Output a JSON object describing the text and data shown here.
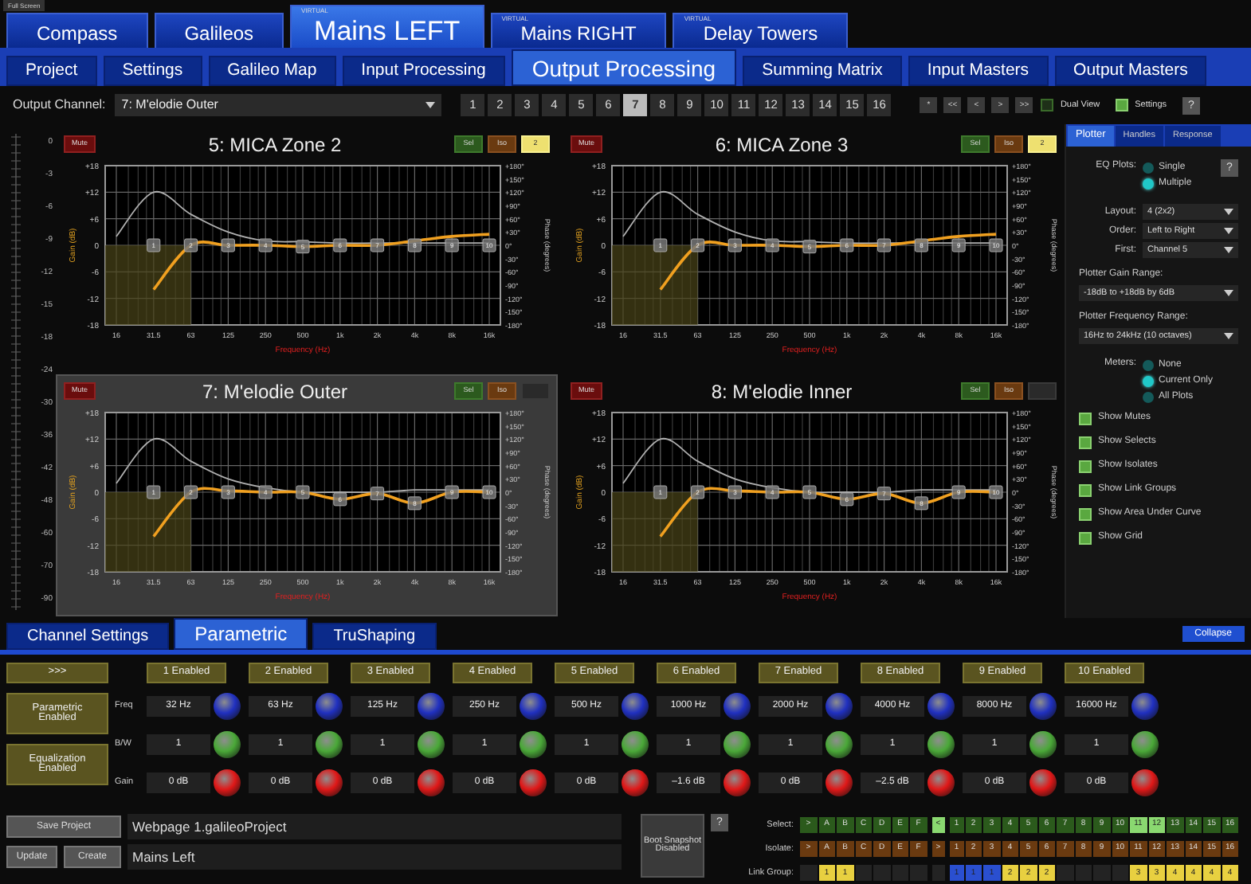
{
  "full_screen_button": "Full Screen",
  "top_tabs": [
    {
      "label": "Compass",
      "selected": false
    },
    {
      "label": "Galileos",
      "selected": false
    },
    {
      "label": "Mains LEFT",
      "tag": "VIRTUAL",
      "selected": true
    },
    {
      "label": "Mains RIGHT",
      "tag": "VIRTUAL",
      "selected": false
    },
    {
      "label": "Delay Towers",
      "tag": "VIRTUAL",
      "selected": false
    }
  ],
  "sub_tabs": [
    {
      "label": "Project",
      "selected": false
    },
    {
      "label": "Settings",
      "selected": false
    },
    {
      "label": "Galileo Map",
      "selected": false
    },
    {
      "label": "Input Processing",
      "selected": false
    },
    {
      "label": "Output Processing",
      "selected": true
    },
    {
      "label": "Summing Matrix",
      "selected": false
    },
    {
      "label": "Input Masters",
      "selected": false
    },
    {
      "label": "Output Masters",
      "selected": false
    }
  ],
  "toolbar": {
    "channel_label": "Output Channel:",
    "channel_value": "7: M'elodie Outer",
    "channels": [
      {
        "label": "1",
        "selected": false
      },
      {
        "label": "2",
        "selected": false
      },
      {
        "label": "3",
        "selected": false
      },
      {
        "label": "4",
        "selected": false
      },
      {
        "label": "5",
        "selected": false
      },
      {
        "label": "6",
        "selected": false
      },
      {
        "label": "7",
        "selected": true
      },
      {
        "label": "8",
        "selected": false
      },
      {
        "label": "9",
        "selected": false
      },
      {
        "label": "10",
        "selected": false
      },
      {
        "label": "11",
        "selected": false
      },
      {
        "label": "12",
        "selected": false
      },
      {
        "label": "13",
        "selected": false
      },
      {
        "label": "14",
        "selected": false
      },
      {
        "label": "15",
        "selected": false
      },
      {
        "label": "16",
        "selected": false
      }
    ],
    "nav_buttons": [
      "*",
      "<<",
      "<",
      ">",
      ">>"
    ],
    "dual_view": {
      "label": "Dual View",
      "checked": false
    },
    "settings": {
      "label": "Settings",
      "checked": true
    },
    "help": "?"
  },
  "meter_scale": [
    "0",
    "-3",
    "-6",
    "-9",
    "-12",
    "-15",
    "-18",
    "-24",
    "-30",
    "-36",
    "-42",
    "-48",
    "-60",
    "-70",
    "-90"
  ],
  "plots": [
    {
      "title": "5: MICA Zone 2",
      "selected": false,
      "mute": "Mute",
      "sel": "Sel",
      "iso": "Iso",
      "link_group": "2",
      "handles": [
        "1",
        "2",
        "3",
        "4",
        "5",
        "6",
        "7",
        "8",
        "9",
        "10"
      ],
      "phase_axis": {
        "label": "Phase (degrees)",
        "ticks": [
          "+180°",
          "+150°",
          "+120°",
          "+90°",
          "+60°",
          "+30°",
          "0°",
          "-30°",
          "-60°",
          "-90°",
          "-120°",
          "-150°",
          "-180°"
        ]
      },
      "chart_data": {
        "type": "line",
        "xlabel": "Frequency (Hz)",
        "ylabel": "Gain (dB)",
        "categories": [
          "16",
          "31.5",
          "63",
          "125",
          "250",
          "500",
          "1k",
          "2k",
          "4k",
          "8k",
          "16k"
        ],
        "ylim": [
          -18,
          18
        ],
        "yticks": [
          {
            "value": 18,
            "label": "+18"
          },
          {
            "value": 12,
            "label": "+12"
          },
          {
            "value": 6,
            "label": "+6"
          },
          {
            "value": 0,
            "label": "0"
          },
          {
            "value": -6,
            "label": "-6"
          },
          {
            "value": -12,
            "label": "-12"
          },
          {
            "value": -18,
            "label": "-18"
          }
        ],
        "grid": true,
        "series": [
          {
            "color": "#f0a020",
            "values": [
              null,
              -10,
              0,
              0,
              0,
              -0.3,
              0,
              0,
              1,
              2,
              2.5
            ]
          },
          {
            "color": "#b0b0b0",
            "values": [
              2,
              12,
              7,
              3,
              1,
              0.8,
              0.5,
              0.5,
              0.5,
              0.5,
              0.5
            ]
          }
        ]
      }
    },
    {
      "title": "6: MICA Zone 3",
      "selected": false,
      "mute": "Mute",
      "sel": "Sel",
      "iso": "Iso",
      "link_group": "2",
      "handles": [
        "1",
        "2",
        "3",
        "4",
        "5",
        "6",
        "7",
        "8",
        "9",
        "10"
      ],
      "phase_axis": {
        "label": "Phase (degrees)",
        "ticks": [
          "+180°",
          "+150°",
          "+120°",
          "+90°",
          "+60°",
          "+30°",
          "0°",
          "-30°",
          "-60°",
          "-90°",
          "-120°",
          "-150°",
          "-180°"
        ]
      },
      "chart_data": {
        "type": "line",
        "xlabel": "Frequency (Hz)",
        "ylabel": "Gain (dB)",
        "categories": [
          "16",
          "31.5",
          "63",
          "125",
          "250",
          "500",
          "1k",
          "2k",
          "4k",
          "8k",
          "16k"
        ],
        "ylim": [
          -18,
          18
        ],
        "yticks": [
          {
            "value": 18,
            "label": "+18"
          },
          {
            "value": 12,
            "label": "+12"
          },
          {
            "value": 6,
            "label": "+6"
          },
          {
            "value": 0,
            "label": "0"
          },
          {
            "value": -6,
            "label": "-6"
          },
          {
            "value": -12,
            "label": "-12"
          },
          {
            "value": -18,
            "label": "-18"
          }
        ],
        "grid": true,
        "series": [
          {
            "color": "#f0a020",
            "values": [
              null,
              -10,
              0,
              0,
              0,
              -0.3,
              0,
              0,
              1,
              2,
              2.5
            ]
          },
          {
            "color": "#b0b0b0",
            "values": [
              2,
              12,
              7,
              3,
              1,
              0.8,
              0.5,
              0.5,
              0.5,
              0.5,
              0.5
            ]
          }
        ]
      }
    },
    {
      "title": "7: M'elodie Outer",
      "selected": true,
      "mute": "Mute",
      "sel": "Sel",
      "iso": "Iso",
      "handles": [
        "1",
        "2",
        "3",
        "4",
        "5",
        "6",
        "7",
        "8",
        "9",
        "10"
      ],
      "phase_axis": {
        "label": "Phase (degrees)",
        "ticks": [
          "+180°",
          "+150°",
          "+120°",
          "+90°",
          "+60°",
          "+30°",
          "0°",
          "-30°",
          "-60°",
          "-90°",
          "-120°",
          "-150°",
          "-180°"
        ]
      },
      "chart_data": {
        "type": "line",
        "xlabel": "Frequency (Hz)",
        "ylabel": "Gain (dB)",
        "categories": [
          "16",
          "31.5",
          "63",
          "125",
          "250",
          "500",
          "1k",
          "2k",
          "4k",
          "8k",
          "16k"
        ],
        "ylim": [
          -18,
          18
        ],
        "yticks": [
          {
            "value": 18,
            "label": "+18"
          },
          {
            "value": 12,
            "label": "+12"
          },
          {
            "value": 6,
            "label": "+6"
          },
          {
            "value": 0,
            "label": "0"
          },
          {
            "value": -6,
            "label": "-6"
          },
          {
            "value": -12,
            "label": "-12"
          },
          {
            "value": -18,
            "label": "-18"
          }
        ],
        "grid": true,
        "series": [
          {
            "color": "#f0a020",
            "values": [
              null,
              -10,
              0,
              0.3,
              0,
              0,
              -1.6,
              -0.3,
              -2.5,
              0,
              0
            ]
          },
          {
            "color": "#b0b0b0",
            "values": [
              2,
              12,
              7,
              3,
              1,
              0,
              0,
              0,
              0.5,
              0.5,
              0.5
            ]
          }
        ]
      }
    },
    {
      "title": "8: M'elodie Inner",
      "selected": false,
      "mute": "Mute",
      "sel": "Sel",
      "iso": "Iso",
      "handles": [
        "1",
        "2",
        "3",
        "4",
        "5",
        "6",
        "7",
        "8",
        "9",
        "10"
      ],
      "phase_axis": {
        "label": "Phase (degrees)",
        "ticks": [
          "+180°",
          "+150°",
          "+120°",
          "+90°",
          "+60°",
          "+30°",
          "0°",
          "-30°",
          "-60°",
          "-90°",
          "-120°",
          "-150°",
          "-180°"
        ]
      },
      "chart_data": {
        "type": "line",
        "xlabel": "Frequency (Hz)",
        "ylabel": "Gain (dB)",
        "categories": [
          "16",
          "31.5",
          "63",
          "125",
          "250",
          "500",
          "1k",
          "2k",
          "4k",
          "8k",
          "16k"
        ],
        "ylim": [
          -18,
          18
        ],
        "yticks": [
          {
            "value": 18,
            "label": "+18"
          },
          {
            "value": 12,
            "label": "+12"
          },
          {
            "value": 6,
            "label": "+6"
          },
          {
            "value": 0,
            "label": "0"
          },
          {
            "value": -6,
            "label": "-6"
          },
          {
            "value": -12,
            "label": "-12"
          },
          {
            "value": -18,
            "label": "-18"
          }
        ],
        "grid": true,
        "series": [
          {
            "color": "#f0a020",
            "values": [
              null,
              -10,
              0,
              0.3,
              0,
              0,
              -1.6,
              -0.3,
              -2.5,
              0,
              0
            ]
          },
          {
            "color": "#b0b0b0",
            "values": [
              2,
              12,
              7,
              3,
              1,
              0,
              0,
              0,
              0.5,
              0.5,
              0.5
            ]
          }
        ]
      }
    }
  ],
  "plotter_panel": {
    "tabs": [
      {
        "label": "Plotter",
        "selected": true
      },
      {
        "label": "Handles",
        "selected": false
      },
      {
        "label": "Response",
        "selected": false
      }
    ],
    "help": "?",
    "eq_plots": {
      "label": "EQ Plots:",
      "options": [
        {
          "label": "Single",
          "selected": false
        },
        {
          "label": "Multiple",
          "selected": true
        }
      ]
    },
    "selects": [
      {
        "label": "Layout:",
        "value": "4 (2x2)"
      },
      {
        "label": "Order:",
        "value": "Left to Right"
      },
      {
        "label": "First:",
        "value": "Channel 5"
      }
    ],
    "ranges": [
      {
        "label": "Plotter Gain Range:",
        "value": "-18dB to +18dB by 6dB"
      },
      {
        "label": "Plotter Frequency Range:",
        "value": "16Hz to 24kHz (10 octaves)"
      }
    ],
    "meters": {
      "label": "Meters:",
      "options": [
        {
          "label": "None",
          "selected": false
        },
        {
          "label": "Current Only",
          "selected": true
        },
        {
          "label": "All Plots",
          "selected": false
        }
      ]
    },
    "checks": [
      {
        "label": "Show Mutes",
        "checked": true
      },
      {
        "label": "Show Selects",
        "checked": true
      },
      {
        "label": "Show Isolates",
        "checked": true
      },
      {
        "label": "Show Link Groups",
        "checked": true
      },
      {
        "label": "Show Area Under Curve",
        "checked": true
      },
      {
        "label": "Show Grid",
        "checked": true
      }
    ]
  },
  "bottom_tabs": [
    {
      "label": "Channel Settings",
      "selected": false
    },
    {
      "label": "Parametric",
      "selected": true
    },
    {
      "label": "TruShaping",
      "selected": false
    }
  ],
  "collapse_button": "Collapse",
  "parametric": {
    "expand_button": ">>>",
    "toggles": [
      "Parametric Enabled",
      "Equalization Enabled"
    ],
    "row_labels": [
      "Freq",
      "B/W",
      "Gain"
    ],
    "bands": [
      {
        "label": "1 Enabled",
        "freq": "32 Hz",
        "bw": "1",
        "gain": "0 dB"
      },
      {
        "label": "2 Enabled",
        "freq": "63 Hz",
        "bw": "1",
        "gain": "0 dB"
      },
      {
        "label": "3 Enabled",
        "freq": "125 Hz",
        "bw": "1",
        "gain": "0 dB"
      },
      {
        "label": "4 Enabled",
        "freq": "250 Hz",
        "bw": "1",
        "gain": "0 dB"
      },
      {
        "label": "5 Enabled",
        "freq": "500 Hz",
        "bw": "1",
        "gain": "0 dB"
      },
      {
        "label": "6 Enabled",
        "freq": "1000 Hz",
        "bw": "1",
        "gain": "–1.6 dB"
      },
      {
        "label": "7 Enabled",
        "freq": "2000 Hz",
        "bw": "1",
        "gain": "0 dB"
      },
      {
        "label": "8 Enabled",
        "freq": "4000 Hz",
        "bw": "1",
        "gain": "–2.5 dB"
      },
      {
        "label": "9 Enabled",
        "freq": "8000 Hz",
        "bw": "1",
        "gain": "0 dB"
      },
      {
        "label": "10 Enabled",
        "freq": "16000 Hz",
        "bw": "1",
        "gain": "0 dB"
      }
    ]
  },
  "project": {
    "save_button": "Save Project",
    "file": "Webpage 1.galileoProject",
    "update_button": "Update",
    "create_button": "Create",
    "name": "Mains Left"
  },
  "snapshot_button": "Boot Snapshot Disabled",
  "groups_help": "?",
  "groups": [
    {
      "kind": "select",
      "label": "Select:",
      "items": [
        {
          "label": ">",
          "selected": false
        },
        {
          "label": "A",
          "selected": false
        },
        {
          "label": "B",
          "selected": false
        },
        {
          "label": "C",
          "selected": false
        },
        {
          "label": "D",
          "selected": false
        },
        {
          "label": "E",
          "selected": false
        },
        {
          "label": "F",
          "selected": false
        },
        {
          "label": "<",
          "selected": true
        },
        {
          "label": "1",
          "selected": false
        },
        {
          "label": "2",
          "selected": false
        },
        {
          "label": "3",
          "selected": false
        },
        {
          "label": "4",
          "selected": false
        },
        {
          "label": "5",
          "selected": false
        },
        {
          "label": "6",
          "selected": false
        },
        {
          "label": "7",
          "selected": false
        },
        {
          "label": "8",
          "selected": false
        },
        {
          "label": "9",
          "selected": false
        },
        {
          "label": "10",
          "selected": false
        },
        {
          "label": "11",
          "selected": true
        },
        {
          "label": "12",
          "selected": true
        },
        {
          "label": "13",
          "selected": false
        },
        {
          "label": "14",
          "selected": false
        },
        {
          "label": "15",
          "selected": false
        },
        {
          "label": "16",
          "selected": false
        }
      ]
    },
    {
      "kind": "isolate",
      "label": "Isolate:",
      "items": [
        {
          "label": ">",
          "selected": false
        },
        {
          "label": "A",
          "selected": false
        },
        {
          "label": "B",
          "selected": false
        },
        {
          "label": "C",
          "selected": false
        },
        {
          "label": "D",
          "selected": false
        },
        {
          "label": "E",
          "selected": false
        },
        {
          "label": "F",
          "selected": false
        },
        {
          "label": ">",
          "selected": false
        },
        {
          "label": "1",
          "selected": false
        },
        {
          "label": "2",
          "selected": false
        },
        {
          "label": "3",
          "selected": false
        },
        {
          "label": "4",
          "selected": false
        },
        {
          "label": "5",
          "selected": false
        },
        {
          "label": "6",
          "selected": false
        },
        {
          "label": "7",
          "selected": false
        },
        {
          "label": "8",
          "selected": false
        },
        {
          "label": "9",
          "selected": false
        },
        {
          "label": "10",
          "selected": false
        },
        {
          "label": "11",
          "selected": false
        },
        {
          "label": "12",
          "selected": false
        },
        {
          "label": "13",
          "selected": false
        },
        {
          "label": "14",
          "selected": false
        },
        {
          "label": "15",
          "selected": false
        },
        {
          "label": "16",
          "selected": false
        }
      ]
    },
    {
      "kind": "link",
      "label": "Link Group:",
      "items": [
        {
          "assigned": false
        },
        {
          "label": "1",
          "color": "#e8d040",
          "assigned": true
        },
        {
          "label": "1",
          "color": "#e8d040",
          "assigned": true
        },
        {
          "assigned": false
        },
        {
          "assigned": false
        },
        {
          "assigned": false
        },
        {
          "assigned": false
        },
        {
          "assigned": false
        },
        {
          "label": "1",
          "color": "#2a4fd0",
          "assigned": true
        },
        {
          "label": "1",
          "color": "#2a4fd0",
          "assigned": true
        },
        {
          "label": "1",
          "color": "#2a4fd0",
          "assigned": true
        },
        {
          "label": "2",
          "color": "#e8d040",
          "assigned": true
        },
        {
          "label": "2",
          "color": "#e8d040",
          "assigned": true
        },
        {
          "label": "2",
          "color": "#e8d040",
          "assigned": true
        },
        {
          "assigned": false
        },
        {
          "assigned": false
        },
        {
          "assigned": false
        },
        {
          "assigned": false
        },
        {
          "label": "3",
          "color": "#e8d040",
          "assigned": true
        },
        {
          "label": "3",
          "color": "#e8d040",
          "assigned": true
        },
        {
          "label": "4",
          "color": "#e8d040",
          "assigned": true
        },
        {
          "label": "4",
          "color": "#e8d040",
          "assigned": true
        },
        {
          "label": "4",
          "color": "#e8d040",
          "assigned": true
        },
        {
          "label": "4",
          "color": "#e8d040",
          "assigned": true
        }
      ]
    }
  ]
}
